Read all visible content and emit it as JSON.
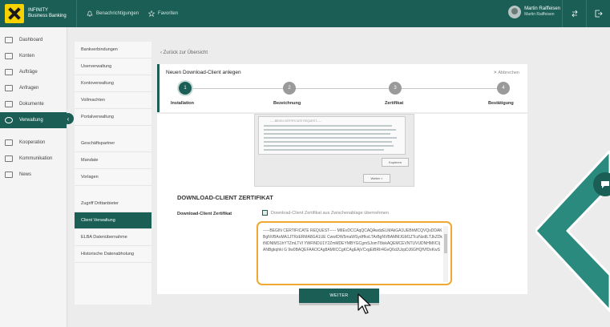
{
  "topbar": {
    "brand_line1": "INFINITY",
    "brand_line2": "Business Banking",
    "notifications": "Benachrichtigungen",
    "favorites": "Favoriten",
    "user_name": "Martin Raiffeisen",
    "user_company": "Martin Raiffeisen"
  },
  "leftnav": {
    "items": [
      {
        "label": "Dashboard"
      },
      {
        "label": "Konten"
      },
      {
        "label": "Aufträge"
      },
      {
        "label": "Anfragen"
      },
      {
        "label": "Dokumente"
      },
      {
        "label": "Verwaltung"
      },
      {
        "label": "Kooperation"
      },
      {
        "label": "Kommunikation"
      },
      {
        "label": "News"
      }
    ],
    "collapse_glyph": "‹"
  },
  "submenu": {
    "items": [
      {
        "label": "Bankverbindungen"
      },
      {
        "label": "Userverwaltung"
      },
      {
        "label": "Kontoverwaltung"
      },
      {
        "label": "Vollmachten"
      },
      {
        "label": "Portalverwaltung"
      },
      {
        "label": "Geschäftspartner"
      },
      {
        "label": "Mandate"
      },
      {
        "label": "Vorlagen"
      },
      {
        "label": "Zugriff Drittanbieter"
      },
      {
        "label": "Client Verwaltung"
      },
      {
        "label": "ELBA Datenübernahme"
      },
      {
        "label": "Historische Datenabholung"
      }
    ]
  },
  "content": {
    "back_link": "Zurück zur Übersicht",
    "wizard_title": "Neuen Download-Client anlegen",
    "cancel": "Abbrechen",
    "steps": [
      {
        "num": "1",
        "label": "Installation"
      },
      {
        "num": "2",
        "label": "Bezeichnung"
      },
      {
        "num": "3",
        "label": "Zertifikat"
      },
      {
        "num": "4",
        "label": "Bestätigung"
      }
    ],
    "screenshot": {
      "header": "-----BEGIN CERTIFICATE REQUEST-----",
      "copy_btn": "Kopieren",
      "next_btn": "Weiter >"
    },
    "section_title": "DOWNLOAD-CLIENT ZERTIFIKAT",
    "field_label": "Download-Client Zertifikat",
    "copy_link": "Download-Client Zertifikat aus Zwischenablage übernehmen",
    "cert_text": "-----BEGIN CERTIFICATE REQUEST----- MIIEvDCCAqQCAQAwdzELMAkGA1UEBhMCQVQxDDAKBgNVBAoMA1JTRzERMA8GA1UE CwwIDW5maWSydHkxLTArBgNVBAMMJGM1ZTczNzdlLTJkZDktNDNlMS1hYTZmLTVl YWFlNDU1Y2ZmMDEYMBYGCgmSJomT8ixkAQEMCEVNTUVUDNHMIICIjANBgkqhki G 9w0BAQEFAAOCAg8AMIICCgKCAgEAjVCxgEiBRIr4GvQ6dJUzpDJ6GHQfVfDxKwS",
    "weiter": "WEITER"
  }
}
